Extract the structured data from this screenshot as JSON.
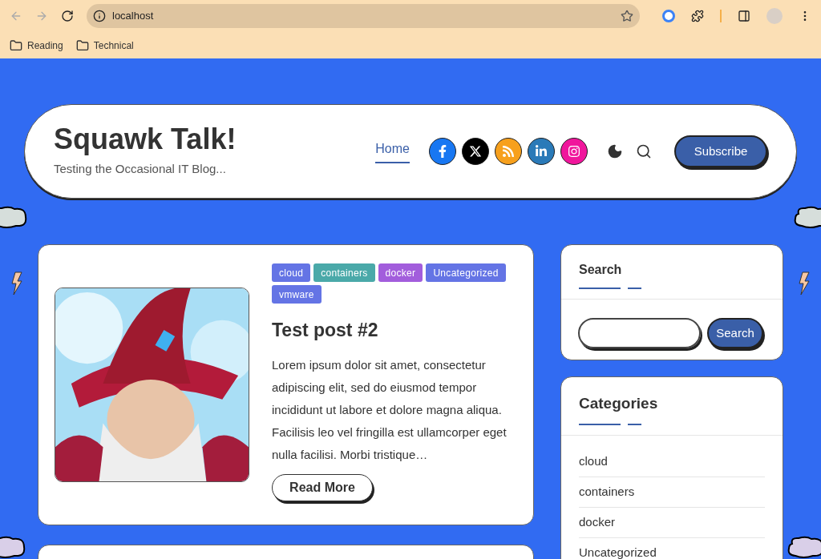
{
  "browser": {
    "address": "localhost",
    "bookmarks": [
      "Reading",
      "Technical"
    ]
  },
  "site": {
    "title": "Squawk Talk!",
    "tagline": "Testing the Occasional IT Blog...",
    "nav": [
      {
        "label": "Home",
        "selected": true
      }
    ],
    "social": [
      {
        "kind": "facebook",
        "color": "#1877f2"
      },
      {
        "kind": "x",
        "color": "#000000"
      },
      {
        "kind": "rss",
        "color": "#f7a01d"
      },
      {
        "kind": "linkedin",
        "color": "#2a7ab8"
      },
      {
        "kind": "instagram",
        "color": "#f0169c"
      }
    ],
    "subscribe": "Subscribe"
  },
  "post": {
    "tags": [
      {
        "label": "cloud",
        "color": "#6474e5"
      },
      {
        "label": "containers",
        "color": "#4aa9a9"
      },
      {
        "label": "docker",
        "color": "#a25ddc"
      },
      {
        "label": "Uncategorized",
        "color": "#6474e5"
      },
      {
        "label": "vmware",
        "color": "#6474e5"
      }
    ],
    "title": "Test post #2",
    "excerpt": "Lorem ipsum dolor sit amet, consectetur adipiscing elit, sed do eiusmod tempor incididunt ut labore et dolore magna aliqua. Facilisis leo vel fringilla est ullamcorper eget nulla facilisi. Morbi tristique…",
    "read_more": "Read More"
  },
  "sidebar": {
    "search": {
      "title": "Search",
      "button": "Search"
    },
    "categories": {
      "title": "Categories",
      "items": [
        "cloud",
        "containers",
        "docker",
        "Uncategorized"
      ]
    }
  }
}
